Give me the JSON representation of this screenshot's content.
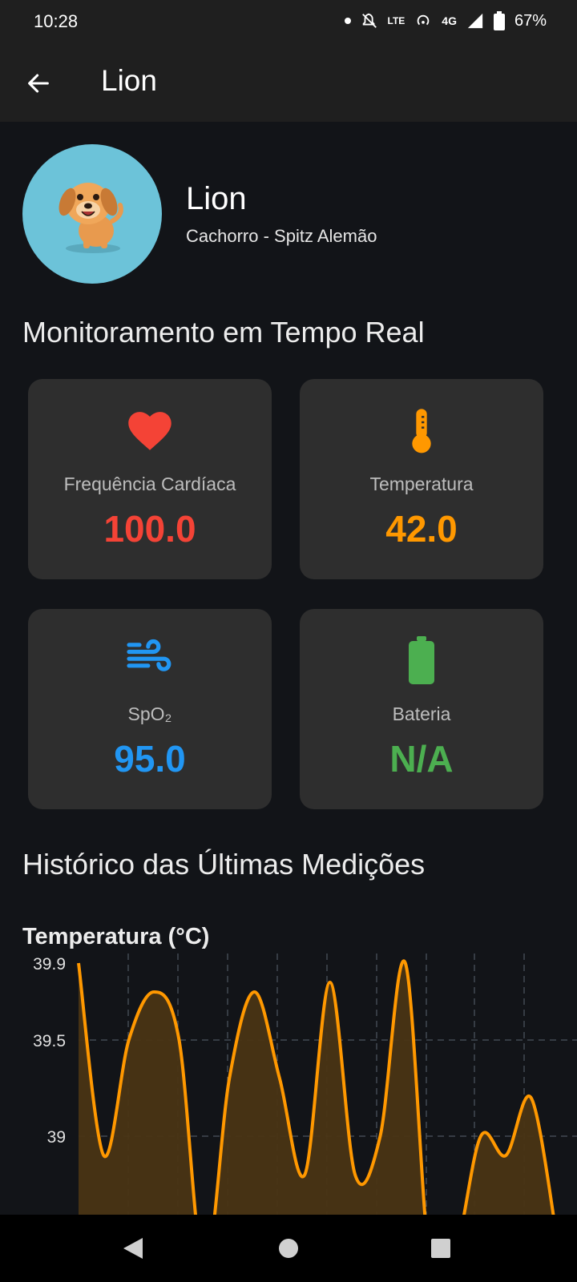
{
  "status_bar": {
    "time": "10:28",
    "network": "4G",
    "volte": "LTE",
    "battery_percent": "67%"
  },
  "app_bar": {
    "title": "Lion"
  },
  "pet": {
    "name": "Lion",
    "description": "Cachorro - Spitz Alemão"
  },
  "monitoring": {
    "title": "Monitoramento em Tempo Real",
    "cards": [
      {
        "label": "Frequência Cardíaca",
        "value": "100.0",
        "color": "#f44336",
        "icon": "heart-icon"
      },
      {
        "label": "Temperatura",
        "value": "42.0",
        "color": "#ff9800",
        "icon": "thermometer-icon"
      },
      {
        "label": "SpO₂",
        "value": "95.0",
        "color": "#2196f3",
        "icon": "wind-icon"
      },
      {
        "label": "Bateria",
        "value": "N/A",
        "color": "#4caf50",
        "icon": "battery-icon"
      }
    ]
  },
  "history": {
    "title": "Histórico das Últimas Medições"
  },
  "chart_data": {
    "type": "area",
    "title": "Temperatura (°C)",
    "ytick_labels": [
      "39.9",
      "39.5",
      "39"
    ],
    "yticks": [
      39.9,
      39.5,
      39.0
    ],
    "ylim_visible": [
      38.3,
      39.9
    ],
    "x": [
      0,
      1,
      2,
      3,
      4,
      5,
      6,
      7,
      8,
      9,
      10,
      11,
      12,
      13,
      14,
      15,
      16,
      17,
      18,
      19
    ],
    "values": [
      39.9,
      38.9,
      39.5,
      39.75,
      39.5,
      38.3,
      39.3,
      39.75,
      39.3,
      38.8,
      39.8,
      38.8,
      39.0,
      39.9,
      38.3,
      38.4,
      39.0,
      38.9,
      39.2,
      38.5
    ],
    "line_color": "#ff9800",
    "fill_color": "#4a3414",
    "grid": true
  }
}
